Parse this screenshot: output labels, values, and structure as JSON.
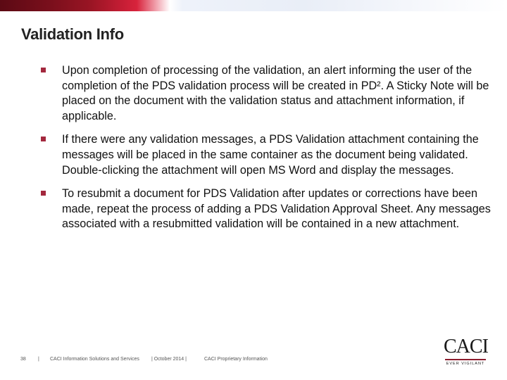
{
  "slide": {
    "title": "Validation Info",
    "bullets": [
      "Upon completion of processing of the validation, an alert informing the user of the completion of the PDS validation process will be created in PD². A Sticky Note will be placed on the document with the validation status and attachment information, if applicable.",
      "If there were any validation messages, a PDS Validation attachment containing the messages will be placed in the same container as the document being validated. Double-clicking the attachment will open MS Word and display the messages.",
      "To resubmit a document for PDS Validation after updates or corrections have been made, repeat the process of adding a PDS Validation Approval Sheet. Any messages associated with a resubmitted validation will be contained in a new attachment."
    ],
    "bullet_color": "#a3283e"
  },
  "footer": {
    "page_number": "38",
    "separator": "|",
    "company": "CACI Information Solutions and Services",
    "date": "| October 2014 |",
    "classification": "CACI Proprietary Information"
  },
  "logo": {
    "wordmark": "CACI",
    "tagline": "EVER VIGILANT",
    "rule_color": "#8c1d2e"
  }
}
